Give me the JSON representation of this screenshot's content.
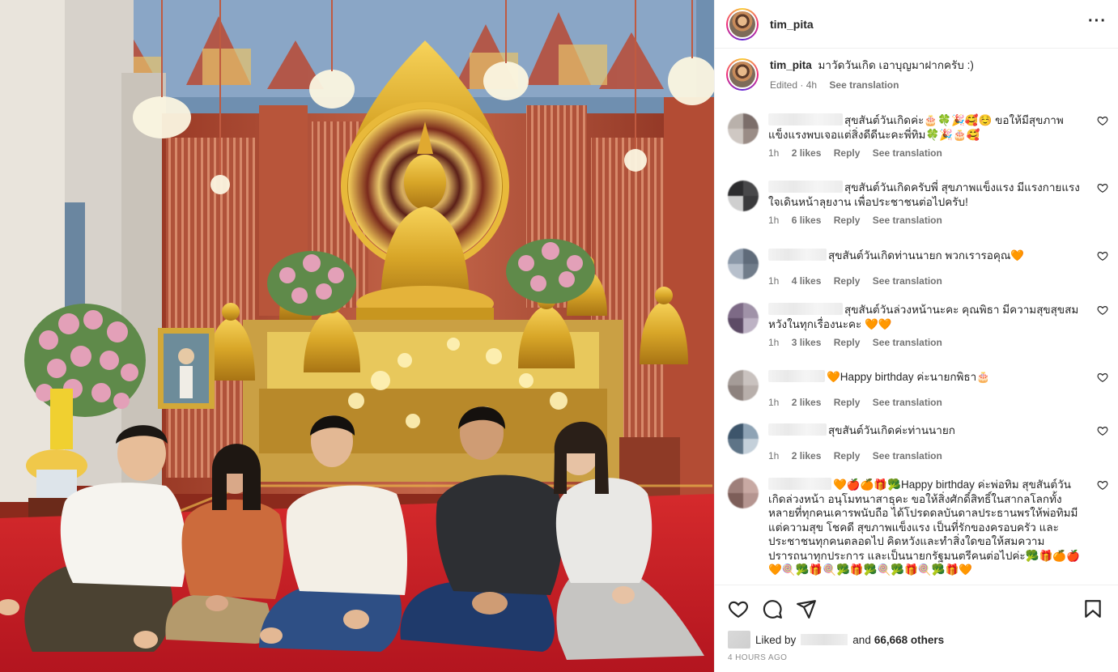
{
  "post": {
    "username": "tim_pita",
    "caption_user": "tim_pita",
    "caption_text": "มาวัดวันเกิด เอาบุญมาฝากครับ :)",
    "caption_edited": "Edited",
    "caption_age": "4h",
    "see_translation": "See translation"
  },
  "comments": [
    {
      "text": "สุขสันต์วันเกิดค่ะ🎂🍀🎉🥰☺️ ขอให้มีสุขภาพแข็งแรงพบเจอแต่สิ่งดีดีนะคะพี่ทิม🍀🎉🎂🥰",
      "age": "1h",
      "likes": "2 likes",
      "reply": "Reply",
      "translate": "See translation",
      "avatar_colors": [
        "#b9b1ab",
        "#7c6e6a",
        "#cfc8c3",
        "#9a8c86"
      ]
    },
    {
      "text": "สุขสันต์วันเกิดครับพี่ สุขภาพแข็งแรง มีแรงกายแรงใจเดินหน้าลุยงาน เพื่อประชาชนต่อไปครับ!",
      "age": "1h",
      "likes": "6 likes",
      "reply": "Reply",
      "translate": "See translation",
      "avatar_colors": [
        "#2c2c2e",
        "#48484a",
        "#cfcfcf",
        "#3a3a3c"
      ]
    },
    {
      "text": "สุขสันต์วันเกิดท่านนายก พวกเรารอคุณ🧡",
      "age": "1h",
      "likes": "4 likes",
      "reply": "Reply",
      "translate": "See translation",
      "avatar_colors": [
        "#8b98a8",
        "#5f6b7a",
        "#b7c0cc",
        "#707c8a"
      ]
    },
    {
      "text": "สุขสันต์วันล่วงหน้านะคะ คุณพิธา มีความสุขสุขสมหวังในทุกเรื่องนะคะ 🧡🧡",
      "age": "1h",
      "likes": "3 likes",
      "reply": "Reply",
      "translate": "See translation",
      "avatar_colors": [
        "#7d6a86",
        "#a092a8",
        "#5d4b66",
        "#bdb2c4"
      ]
    },
    {
      "text": "🧡Happy birthday ค่ะนายกพิธา🎂",
      "age": "1h",
      "likes": "2 likes",
      "reply": "Reply",
      "translate": "See translation",
      "avatar_colors": [
        "#a59c98",
        "#c9c2bf",
        "#8d827e",
        "#b8afab"
      ]
    },
    {
      "text": "สุขสันต์วันเกิดค่ะท่านนายก",
      "age": "1h",
      "likes": "2 likes",
      "reply": "Reply",
      "translate": "See translation",
      "avatar_colors": [
        "#3d556b",
        "#8ea3b5",
        "#5e7487",
        "#c4d0da"
      ]
    },
    {
      "text": "🧡🍎🍊🎁🥦Happy birthday ค่ะพ่อทิม สุขสันต์วันเกิดล่วงหน้า อนุโมทนาสาธุคะ ขอให้สิ่งศักดิ์สิทธิ์ในสากลโลกทั้งหลายที่ทุกคนเคารพนับถือ ได้โปรดดลบันดาลประธานพรให้พ่อทิมมีแต่ความสุข โชคดี สุขภาพแข็งแรง เป็นที่รักของครอบครัว และประชาชนทุกคนตลอดไป คิดหวังและทำสิ่งใดขอให้สมความปรารถนาทุกประการ และเป็นนายกรัฐมนตรีคนต่อไปค่ะ🥦🎁🍊🍎🧡🍭🥦🎁🍭🥦🎁🥦🍭🥦🎁🍭🥦🎁🧡",
      "age": "",
      "likes": "",
      "reply": "",
      "translate": "",
      "avatar_colors": [
        "#9e7f7a",
        "#c8a9a3",
        "#7d5e59",
        "#b59590"
      ]
    }
  ],
  "footer": {
    "liked_prefix": "Liked by",
    "and_text": "and",
    "others": "66,668 others",
    "timestamp": "4 HOURS AGO"
  },
  "icons": {
    "like": "heart-icon",
    "comment": "comment-icon",
    "share": "share-icon",
    "save": "bookmark-icon",
    "more": "more-options-icon"
  },
  "colors": {
    "photo_carpet": "#c8202a",
    "temple_gold": "#d8a628",
    "heart_emoji": "#f0752a",
    "text_primary": "#262626",
    "text_secondary": "#737373"
  }
}
